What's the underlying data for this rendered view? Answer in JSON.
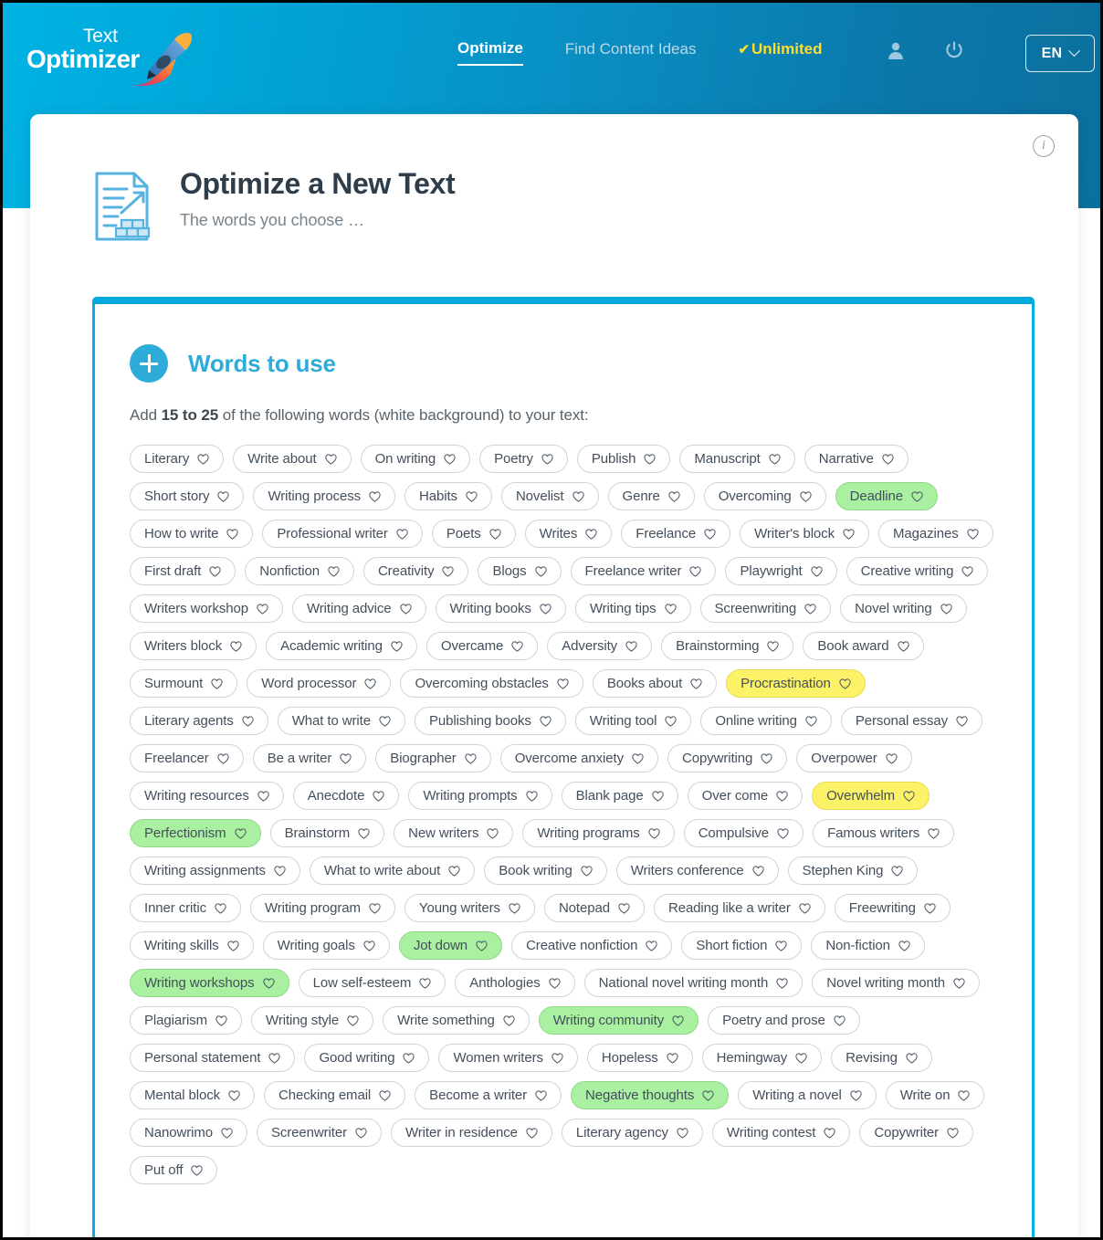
{
  "nav": {
    "logo_line1": "Text",
    "logo_line2": "Optimizer",
    "logo_icon": "rocket-pencil-icon",
    "links": [
      {
        "label": "Optimize",
        "state": "active"
      },
      {
        "label": "Find Content Ideas",
        "state": "muted"
      },
      {
        "label": "Unlimited",
        "state": "plan",
        "check": "✔"
      }
    ],
    "icons": [
      "user-icon",
      "power-icon"
    ],
    "language": {
      "code": "EN",
      "caret": "chevron-down-icon"
    }
  },
  "page": {
    "info_badge": "i",
    "icon": "document-optimize-icon",
    "title": "Optimize a New Text",
    "subtitle": "The words you choose …"
  },
  "panel": {
    "plus_icon": "plus-circle-icon",
    "title": "Words to use",
    "hint_prefix": "Add ",
    "hint_bold": "15 to 25",
    "hint_suffix": " of the following words (white background) to your text:",
    "heart_icon": "heart-outline-icon",
    "tags": [
      {
        "label": "Literary",
        "highlight": "none"
      },
      {
        "label": "Write about",
        "highlight": "none"
      },
      {
        "label": "On writing",
        "highlight": "none"
      },
      {
        "label": "Poetry",
        "highlight": "none"
      },
      {
        "label": "Publish",
        "highlight": "none"
      },
      {
        "label": "Manuscript",
        "highlight": "none"
      },
      {
        "label": "Narrative",
        "highlight": "none"
      },
      {
        "label": "Short story",
        "highlight": "none"
      },
      {
        "label": "Writing process",
        "highlight": "none"
      },
      {
        "label": "Habits",
        "highlight": "none"
      },
      {
        "label": "Novelist",
        "highlight": "none"
      },
      {
        "label": "Genre",
        "highlight": "none"
      },
      {
        "label": "Overcoming",
        "highlight": "none"
      },
      {
        "label": "Deadline",
        "highlight": "green"
      },
      {
        "label": "How to write",
        "highlight": "none"
      },
      {
        "label": "Professional writer",
        "highlight": "none"
      },
      {
        "label": "Poets",
        "highlight": "none"
      },
      {
        "label": "Writes",
        "highlight": "none"
      },
      {
        "label": "Freelance",
        "highlight": "none"
      },
      {
        "label": "Writer's block",
        "highlight": "none"
      },
      {
        "label": "Magazines",
        "highlight": "none"
      },
      {
        "label": "First draft",
        "highlight": "none"
      },
      {
        "label": "Nonfiction",
        "highlight": "none"
      },
      {
        "label": "Creativity",
        "highlight": "none"
      },
      {
        "label": "Blogs",
        "highlight": "none"
      },
      {
        "label": "Freelance writer",
        "highlight": "none"
      },
      {
        "label": "Playwright",
        "highlight": "none"
      },
      {
        "label": "Creative writing",
        "highlight": "none"
      },
      {
        "label": "Writers workshop",
        "highlight": "none"
      },
      {
        "label": "Writing advice",
        "highlight": "none"
      },
      {
        "label": "Writing books",
        "highlight": "none"
      },
      {
        "label": "Writing tips",
        "highlight": "none"
      },
      {
        "label": "Screenwriting",
        "highlight": "none"
      },
      {
        "label": "Novel writing",
        "highlight": "none"
      },
      {
        "label": "Writers block",
        "highlight": "none"
      },
      {
        "label": "Academic writing",
        "highlight": "none"
      },
      {
        "label": "Overcame",
        "highlight": "none"
      },
      {
        "label": "Adversity",
        "highlight": "none"
      },
      {
        "label": "Brainstorming",
        "highlight": "none"
      },
      {
        "label": "Book award",
        "highlight": "none"
      },
      {
        "label": "Surmount",
        "highlight": "none"
      },
      {
        "label": "Word processor",
        "highlight": "none"
      },
      {
        "label": "Overcoming obstacles",
        "highlight": "none"
      },
      {
        "label": "Books about",
        "highlight": "none"
      },
      {
        "label": "Procrastination",
        "highlight": "yellow"
      },
      {
        "label": "Literary agents",
        "highlight": "none"
      },
      {
        "label": "What to write",
        "highlight": "none"
      },
      {
        "label": "Publishing books",
        "highlight": "none"
      },
      {
        "label": "Writing tool",
        "highlight": "none"
      },
      {
        "label": "Online writing",
        "highlight": "none"
      },
      {
        "label": "Personal essay",
        "highlight": "none"
      },
      {
        "label": "Freelancer",
        "highlight": "none"
      },
      {
        "label": "Be a writer",
        "highlight": "none"
      },
      {
        "label": "Biographer",
        "highlight": "none"
      },
      {
        "label": "Overcome anxiety",
        "highlight": "none"
      },
      {
        "label": "Copywriting",
        "highlight": "none"
      },
      {
        "label": "Overpower",
        "highlight": "none"
      },
      {
        "label": "Writing resources",
        "highlight": "none"
      },
      {
        "label": "Anecdote",
        "highlight": "none"
      },
      {
        "label": "Writing prompts",
        "highlight": "none"
      },
      {
        "label": "Blank page",
        "highlight": "none"
      },
      {
        "label": "Over come",
        "highlight": "none"
      },
      {
        "label": "Overwhelm",
        "highlight": "yellow"
      },
      {
        "label": "Perfectionism",
        "highlight": "green"
      },
      {
        "label": "Brainstorm",
        "highlight": "none"
      },
      {
        "label": "New writers",
        "highlight": "none"
      },
      {
        "label": "Writing programs",
        "highlight": "none"
      },
      {
        "label": "Compulsive",
        "highlight": "none"
      },
      {
        "label": "Famous writers",
        "highlight": "none"
      },
      {
        "label": "Writing assignments",
        "highlight": "none"
      },
      {
        "label": "What to write about",
        "highlight": "none"
      },
      {
        "label": "Book writing",
        "highlight": "none"
      },
      {
        "label": "Writers conference",
        "highlight": "none"
      },
      {
        "label": "Stephen King",
        "highlight": "none"
      },
      {
        "label": "Inner critic",
        "highlight": "none"
      },
      {
        "label": "Writing program",
        "highlight": "none"
      },
      {
        "label": "Young writers",
        "highlight": "none"
      },
      {
        "label": "Notepad",
        "highlight": "none"
      },
      {
        "label": "Reading like a writer",
        "highlight": "none"
      },
      {
        "label": "Freewriting",
        "highlight": "none"
      },
      {
        "label": "Writing skills",
        "highlight": "none"
      },
      {
        "label": "Writing goals",
        "highlight": "none"
      },
      {
        "label": "Jot down",
        "highlight": "green"
      },
      {
        "label": "Creative nonfiction",
        "highlight": "none"
      },
      {
        "label": "Short fiction",
        "highlight": "none"
      },
      {
        "label": "Non-fiction",
        "highlight": "none"
      },
      {
        "label": "Writing workshops",
        "highlight": "green"
      },
      {
        "label": "Low self-esteem",
        "highlight": "none"
      },
      {
        "label": "Anthologies",
        "highlight": "none"
      },
      {
        "label": "National novel writing month",
        "highlight": "none"
      },
      {
        "label": "Novel writing month",
        "highlight": "none"
      },
      {
        "label": "Plagiarism",
        "highlight": "none"
      },
      {
        "label": "Writing style",
        "highlight": "none"
      },
      {
        "label": "Write something",
        "highlight": "none"
      },
      {
        "label": "Writing community",
        "highlight": "green"
      },
      {
        "label": "Poetry and prose",
        "highlight": "none"
      },
      {
        "label": "Personal statement",
        "highlight": "none"
      },
      {
        "label": "Good writing",
        "highlight": "none"
      },
      {
        "label": "Women writers",
        "highlight": "none"
      },
      {
        "label": "Hopeless",
        "highlight": "none"
      },
      {
        "label": "Hemingway",
        "highlight": "none"
      },
      {
        "label": "Revising",
        "highlight": "none"
      },
      {
        "label": "Mental block",
        "highlight": "none"
      },
      {
        "label": "Checking email",
        "highlight": "none"
      },
      {
        "label": "Become a writer",
        "highlight": "none"
      },
      {
        "label": "Negative thoughts",
        "highlight": "green"
      },
      {
        "label": "Writing a novel",
        "highlight": "none"
      },
      {
        "label": "Write on",
        "highlight": "none"
      },
      {
        "label": "Nanowrimo",
        "highlight": "none"
      },
      {
        "label": "Screenwriter",
        "highlight": "none"
      },
      {
        "label": "Writer in residence",
        "highlight": "none"
      },
      {
        "label": "Literary agency",
        "highlight": "none"
      },
      {
        "label": "Writing contest",
        "highlight": "none"
      },
      {
        "label": "Copywriter",
        "highlight": "none"
      },
      {
        "label": "Put off",
        "highlight": "none"
      }
    ]
  },
  "colors": {
    "header_cyan": "#00b3e3",
    "header_blue": "#0b6f9e",
    "accent": "#2dacd9",
    "panel_bar": "#00aadd",
    "highlight_green": "#a9f0a0",
    "highlight_yellow": "#fbf267",
    "plan_yellow": "#ffdd2a",
    "title_dark": "#2e3d49"
  }
}
